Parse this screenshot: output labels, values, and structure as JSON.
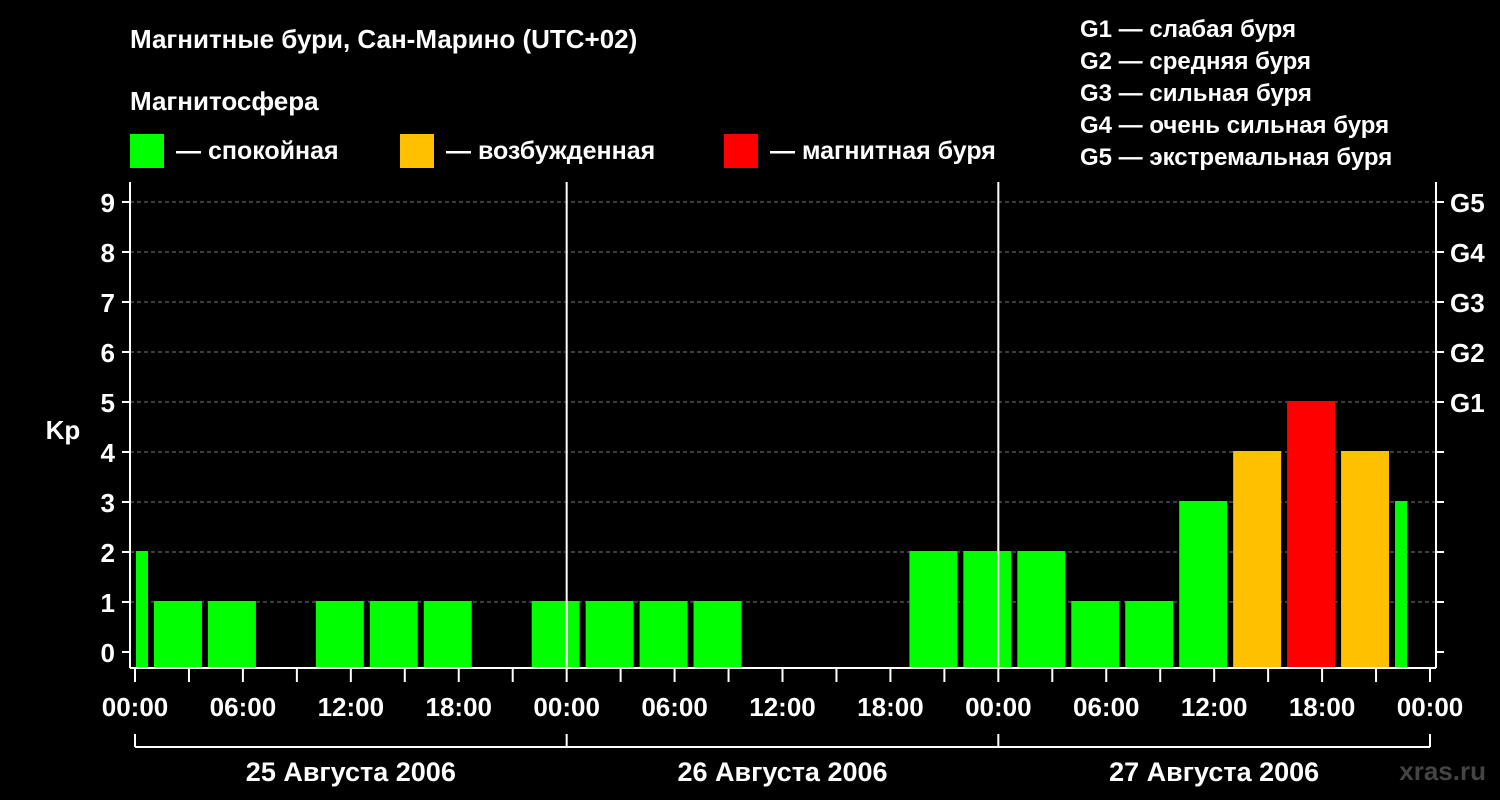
{
  "title": "Магнитные бури, Сан-Марино (UTC+02)",
  "subtitle": "Магнитосфера",
  "legend": [
    {
      "label": "— спокойная",
      "color": "#00ff00"
    },
    {
      "label": "— возбужденная",
      "color": "#ffc000"
    },
    {
      "label": "— магнитная буря",
      "color": "#ff0000"
    }
  ],
  "g_legend": [
    "G1 — слабая буря",
    "G2 — средняя буря",
    "G3 — сильная буря",
    "G4 — очень сильная буря",
    "G5 — экстремальная буря"
  ],
  "watermark": "xras.ru",
  "colors": {
    "quiet": "#00ff00",
    "active": "#ffc000",
    "storm": "#ff0000"
  },
  "chart_data": {
    "type": "bar",
    "ylabel": "Kp",
    "ylim": [
      0,
      9
    ],
    "yticks": [
      "0",
      "1",
      "2",
      "3",
      "4",
      "5",
      "6",
      "7",
      "8",
      "9"
    ],
    "g_labels": [
      {
        "kp": 5,
        "label": "G1"
      },
      {
        "kp": 6,
        "label": "G2"
      },
      {
        "kp": 7,
        "label": "G3"
      },
      {
        "kp": 8,
        "label": "G4"
      },
      {
        "kp": 9,
        "label": "G5"
      }
    ],
    "x_tick_labels": [
      "00:00",
      "06:00",
      "12:00",
      "18:00",
      "00:00",
      "06:00",
      "12:00",
      "18:00",
      "00:00",
      "06:00",
      "12:00",
      "18:00",
      "00:00"
    ],
    "days": [
      "25 Августа 2006",
      "26 Августа 2006",
      "27 Августа 2006"
    ],
    "grid": true,
    "bars": [
      {
        "start_hour": 0,
        "end_hour": 1,
        "kp": 2,
        "level": "quiet"
      },
      {
        "start_hour": 1,
        "end_hour": 4,
        "kp": 1,
        "level": "quiet"
      },
      {
        "start_hour": 4,
        "end_hour": 7,
        "kp": 1,
        "level": "quiet"
      },
      {
        "start_hour": 7,
        "end_hour": 10,
        "kp": 0,
        "level": "quiet"
      },
      {
        "start_hour": 10,
        "end_hour": 13,
        "kp": 1,
        "level": "quiet"
      },
      {
        "start_hour": 13,
        "end_hour": 16,
        "kp": 1,
        "level": "quiet"
      },
      {
        "start_hour": 16,
        "end_hour": 19,
        "kp": 1,
        "level": "quiet"
      },
      {
        "start_hour": 19,
        "end_hour": 22,
        "kp": 0,
        "level": "quiet"
      },
      {
        "start_hour": 22,
        "end_hour": 25,
        "kp": 1,
        "level": "quiet"
      },
      {
        "start_hour": 25,
        "end_hour": 28,
        "kp": 1,
        "level": "quiet"
      },
      {
        "start_hour": 28,
        "end_hour": 31,
        "kp": 1,
        "level": "quiet"
      },
      {
        "start_hour": 31,
        "end_hour": 34,
        "kp": 1,
        "level": "quiet"
      },
      {
        "start_hour": 34,
        "end_hour": 37,
        "kp": 0,
        "level": "quiet"
      },
      {
        "start_hour": 37,
        "end_hour": 40,
        "kp": 0,
        "level": "quiet"
      },
      {
        "start_hour": 40,
        "end_hour": 43,
        "kp": 0,
        "level": "quiet"
      },
      {
        "start_hour": 43,
        "end_hour": 46,
        "kp": 2,
        "level": "quiet"
      },
      {
        "start_hour": 46,
        "end_hour": 49,
        "kp": 2,
        "level": "quiet"
      },
      {
        "start_hour": 49,
        "end_hour": 52,
        "kp": 2,
        "level": "quiet"
      },
      {
        "start_hour": 52,
        "end_hour": 55,
        "kp": 1,
        "level": "quiet"
      },
      {
        "start_hour": 55,
        "end_hour": 58,
        "kp": 1,
        "level": "quiet"
      },
      {
        "start_hour": 58,
        "end_hour": 61,
        "kp": 3,
        "level": "quiet"
      },
      {
        "start_hour": 61,
        "end_hour": 64,
        "kp": 4,
        "level": "active"
      },
      {
        "start_hour": 64,
        "end_hour": 67,
        "kp": 5,
        "level": "storm"
      },
      {
        "start_hour": 67,
        "end_hour": 70,
        "kp": 4,
        "level": "active"
      },
      {
        "start_hour": 70,
        "end_hour": 71,
        "kp": 3,
        "level": "quiet"
      }
    ]
  }
}
